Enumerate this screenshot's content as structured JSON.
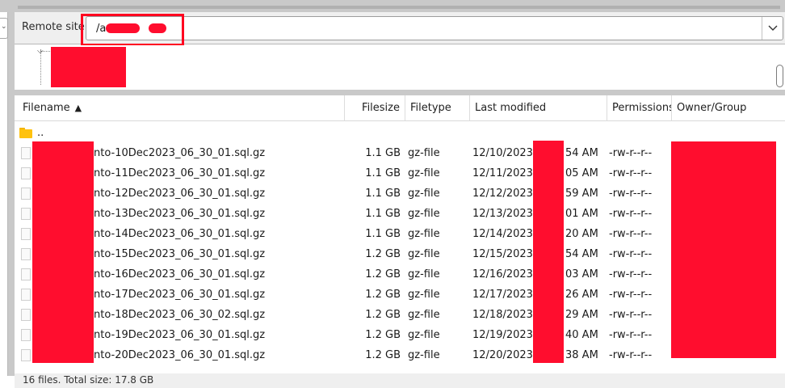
{
  "remote_site": {
    "label": "Remote site:",
    "path": "/a          s/      d"
  },
  "columns": [
    {
      "label": "Filename",
      "sort": "ascending"
    },
    {
      "label": "Filesize"
    },
    {
      "label": "Filetype"
    },
    {
      "label": "Last modified"
    },
    {
      "label": "Permissions"
    },
    {
      "label": "Owner/Group"
    }
  ],
  "parent_dir": "..",
  "files": [
    {
      "name": "nto-10Dec2023_06_30_01.sql.gz",
      "size": "1.1 GB",
      "type": "gz-file",
      "date": "12/10/2023",
      "time": "54 AM",
      "perms": "-rw-r--r--"
    },
    {
      "name": "nto-11Dec2023_06_30_01.sql.gz",
      "size": "1.1 GB",
      "type": "gz-file",
      "date": "12/11/2023",
      "time": "05 AM",
      "perms": "-rw-r--r--"
    },
    {
      "name": "nto-12Dec2023_06_30_01.sql.gz",
      "size": "1.1 GB",
      "type": "gz-file",
      "date": "12/12/2023",
      "time": "59 AM",
      "perms": "-rw-r--r--"
    },
    {
      "name": "nto-13Dec2023_06_30_01.sql.gz",
      "size": "1.1 GB",
      "type": "gz-file",
      "date": "12/13/2023",
      "time": "01 AM",
      "perms": "-rw-r--r--"
    },
    {
      "name": "nto-14Dec2023_06_30_01.sql.gz",
      "size": "1.1 GB",
      "type": "gz-file",
      "date": "12/14/2023",
      "time": "20 AM",
      "perms": "-rw-r--r--"
    },
    {
      "name": "nto-15Dec2023_06_30_01.sql.gz",
      "size": "1.2 GB",
      "type": "gz-file",
      "date": "12/15/2023",
      "time": "54 AM",
      "perms": "-rw-r--r--"
    },
    {
      "name": "nto-16Dec2023_06_30_01.sql.gz",
      "size": "1.2 GB",
      "type": "gz-file",
      "date": "12/16/2023",
      "time": "03 AM",
      "perms": "-rw-r--r--"
    },
    {
      "name": "nto-17Dec2023_06_30_01.sql.gz",
      "size": "1.2 GB",
      "type": "gz-file",
      "date": "12/17/2023",
      "time": "26 AM",
      "perms": "-rw-r--r--"
    },
    {
      "name": "nto-18Dec2023_06_30_02.sql.gz",
      "size": "1.2 GB",
      "type": "gz-file",
      "date": "12/18/2023",
      "time": "29 AM",
      "perms": "-rw-r--r--"
    },
    {
      "name": "nto-19Dec2023_06_30_01.sql.gz",
      "size": "1.2 GB",
      "type": "gz-file",
      "date": "12/19/2023",
      "time": "40 AM",
      "perms": "-rw-r--r--"
    },
    {
      "name": "nto-20Dec2023_06_30_01.sql.gz",
      "size": "1.2 GB",
      "type": "gz-file",
      "date": "12/20/2023",
      "time": "38 AM",
      "perms": "-rw-r--r--"
    }
  ],
  "status": "16 files. Total size: 17.8 GB",
  "colors": {
    "redaction": "#ff0d2e",
    "folder": "#ffc20e",
    "highlight_border": "#ff0020"
  }
}
